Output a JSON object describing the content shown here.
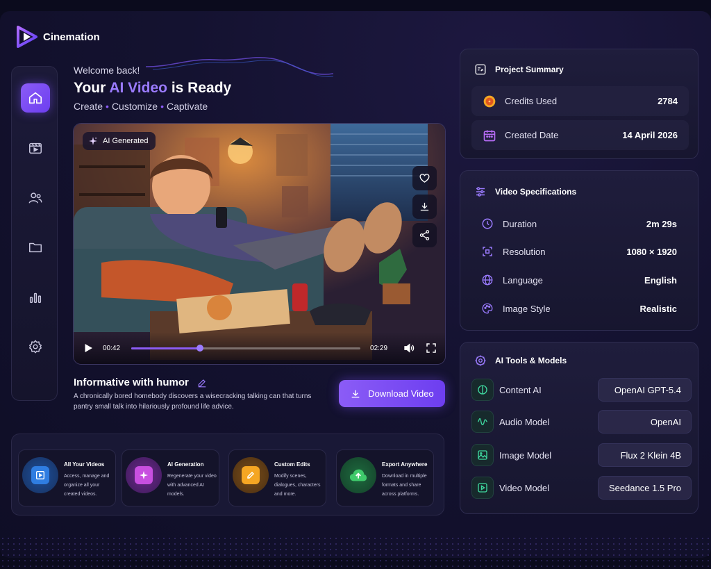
{
  "app": {
    "name": "Cinemation"
  },
  "header": {
    "welcome": "Welcome back!",
    "headline_pre": "Your ",
    "headline_accent": "AI Video",
    "headline_post": " is Ready",
    "tagline": [
      "Create",
      "Customize",
      "Captivate"
    ]
  },
  "sidebar": {
    "items": [
      {
        "icon": "home-icon",
        "active": true
      },
      {
        "icon": "video-icon",
        "active": false
      },
      {
        "icon": "users-icon",
        "active": false
      },
      {
        "icon": "folder-icon",
        "active": false
      },
      {
        "icon": "analytics-icon",
        "active": false
      },
      {
        "icon": "settings-icon",
        "active": false
      }
    ]
  },
  "video": {
    "badge": "AI Generated",
    "current_time": "00:42",
    "duration": "02:29",
    "progress_fraction": 0.3,
    "title": "Informative with humor",
    "description": "A chronically bored homebody discovers a wisecracking talking can that turns pantry small talk into hilariously profound life advice.",
    "download_label": "Download Video"
  },
  "features": [
    {
      "title": "All Your Videos",
      "desc": "Access, manage and organize all your created videos.",
      "icon": "video-library-icon",
      "color": "#2f7de1"
    },
    {
      "title": "AI Generation",
      "desc": "Regenerate your video with advanced AI models.",
      "icon": "sparkle-icon",
      "color": "#c84fe0"
    },
    {
      "title": "Custom Edits",
      "desc": "Modify scenes, dialogues, characters and more.",
      "icon": "edit-icon",
      "color": "#f5a623"
    },
    {
      "title": "Export Anywhere",
      "desc": "Download in multiple formats and share across platforms.",
      "icon": "cloud-upload-icon",
      "color": "#3fca6b"
    }
  ],
  "project_summary": {
    "title": "Project Summary",
    "rows": [
      {
        "label": "Credits Used",
        "value": "2784",
        "icon": "coin-icon"
      },
      {
        "label": "Created Date",
        "value": "14 April 2026",
        "icon": "calendar-icon"
      }
    ]
  },
  "video_specs": {
    "title": "Video Specifications",
    "rows": [
      {
        "label": "Duration",
        "value": "2m 29s",
        "icon": "clock-icon"
      },
      {
        "label": "Resolution",
        "value": "1080 × 1920",
        "icon": "resolution-icon"
      },
      {
        "label": "Language",
        "value": "English",
        "icon": "globe-icon"
      },
      {
        "label": "Image Style",
        "value": "Realistic",
        "icon": "palette-icon"
      }
    ]
  },
  "ai_tools": {
    "title": "AI Tools & Models",
    "rows": [
      {
        "label": "Content AI",
        "value": "OpenAI GPT-5.4",
        "icon": "openai-icon"
      },
      {
        "label": "Audio Model",
        "value": "OpenAI",
        "icon": "waveform-icon"
      },
      {
        "label": "Image Model",
        "value": "Flux 2 Klein 4B",
        "icon": "image-icon"
      },
      {
        "label": "Video Model",
        "value": "Seedance 1.5 Pro",
        "icon": "play-icon"
      }
    ]
  },
  "colors": {
    "accent": "#8b5cf6",
    "accent_light": "#9b7bff",
    "background": "#0f0e26",
    "panel": "#1f1d3c"
  }
}
